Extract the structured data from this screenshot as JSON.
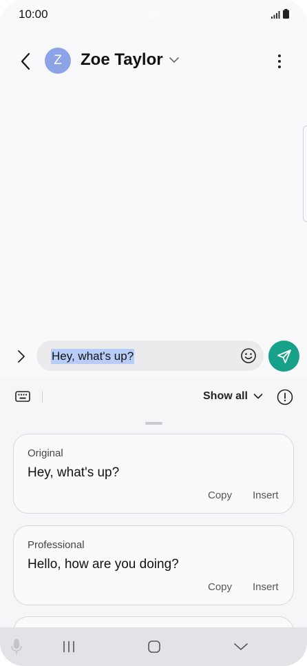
{
  "status_bar": {
    "time": "10:00"
  },
  "header": {
    "avatar_initial": "Z",
    "contact_name": "Zoe Taylor"
  },
  "composer": {
    "text": "Hey, what's up?"
  },
  "toolbar": {
    "show_all_label": "Show all"
  },
  "suggestions": [
    {
      "label": "Original",
      "text": "Hey, what's up?",
      "copy_label": "Copy",
      "insert_label": "Insert"
    },
    {
      "label": "Professional",
      "text": "Hello, how are you doing?",
      "copy_label": "Copy",
      "insert_label": "Insert"
    }
  ],
  "colors": {
    "send_button": "#17a08a",
    "avatar": "#8ea3e6",
    "selection": "#b7cdf7"
  },
  "icons": [
    "back-arrow-icon",
    "chevron-down-icon",
    "more-vertical-icon",
    "expand-chevron-icon",
    "emoji-icon",
    "send-icon",
    "keyboard-icon",
    "info-icon",
    "microphone-icon",
    "recent-apps-icon",
    "home-icon",
    "hide-keyboard-icon"
  ]
}
